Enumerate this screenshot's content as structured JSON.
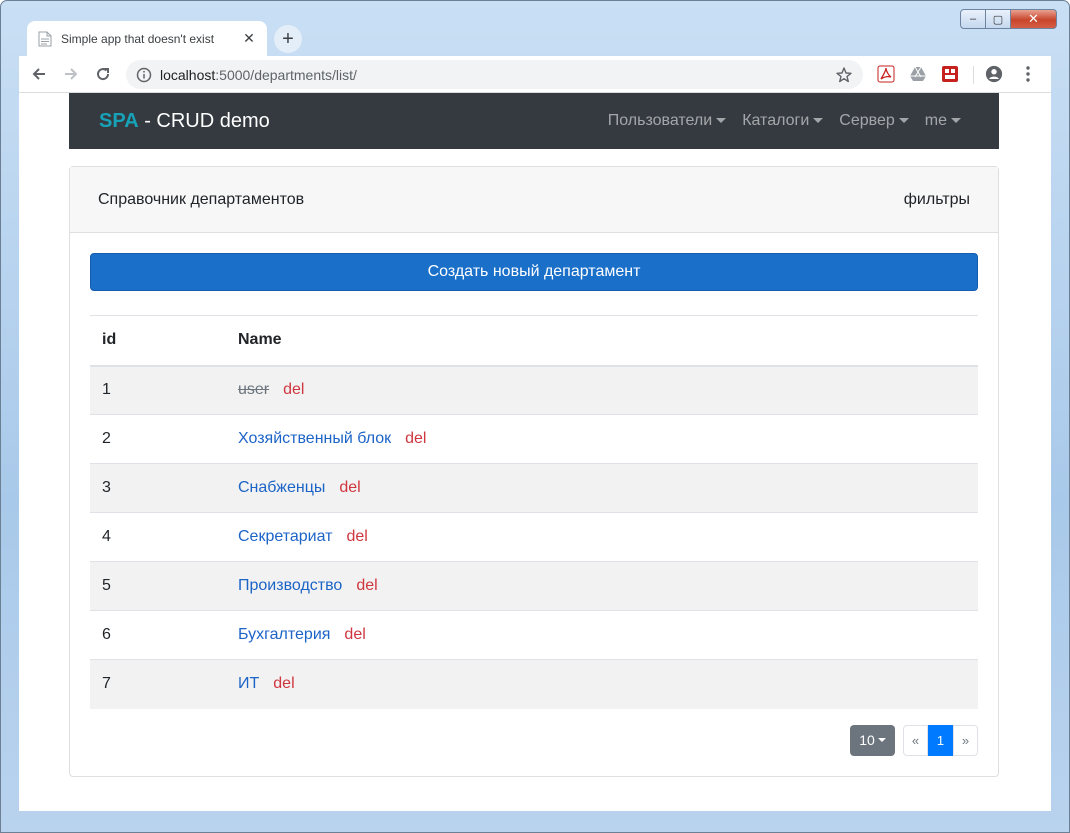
{
  "browser": {
    "tab_title": "Simple app that doesn't exist",
    "tab_close": "✕",
    "new_tab": "+",
    "window_controls": {
      "minimize": "–",
      "maximize": "▢",
      "close": "✕"
    },
    "url_host": "localhost",
    "url_path": ":5000/departments/list/",
    "extensions": [
      "pdf-icon",
      "drive-icon",
      "extension-icon"
    ],
    "colors": {
      "accent": "#1a73e8"
    }
  },
  "navbar": {
    "brand_accent": "SPA",
    "brand_rest": " - CRUD demo",
    "menu": [
      {
        "label": "Пользователи"
      },
      {
        "label": "Каталоги"
      },
      {
        "label": "Сервер"
      },
      {
        "label": "me"
      }
    ]
  },
  "card": {
    "title": "Справочник департаментов",
    "filters": "фильтры",
    "create_button": "Создать новый департамент"
  },
  "table": {
    "headers": {
      "id": "id",
      "name": "Name"
    },
    "rows": [
      {
        "id": "1",
        "name": "user",
        "del": "del",
        "struck": true
      },
      {
        "id": "2",
        "name": "Хозяйственный блок",
        "del": "del",
        "struck": false
      },
      {
        "id": "3",
        "name": "Снабженцы",
        "del": "del",
        "struck": false
      },
      {
        "id": "4",
        "name": "Секретариат",
        "del": "del",
        "struck": false
      },
      {
        "id": "5",
        "name": "Производство",
        "del": "del",
        "struck": false
      },
      {
        "id": "6",
        "name": "Бухгалтерия",
        "del": "del",
        "struck": false
      },
      {
        "id": "7",
        "name": "ИТ",
        "del": "del",
        "struck": false
      }
    ]
  },
  "pager": {
    "page_size": "10",
    "prev": "«",
    "current": "1",
    "next": "»"
  }
}
